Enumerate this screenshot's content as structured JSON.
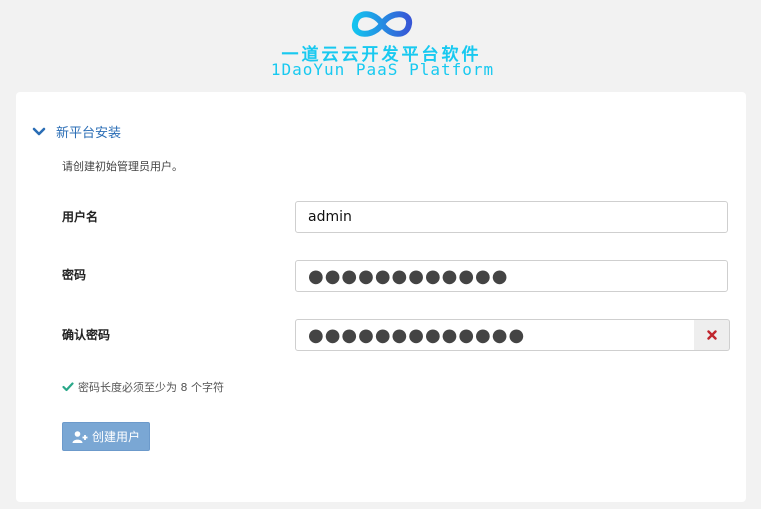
{
  "brand": {
    "name_cn": "一道云云开发平台软件",
    "name_en": "1DaoYun PaaS Platform",
    "accent_color": "#18c9f0",
    "logo_icon": "infinity-logo-icon"
  },
  "section": {
    "title": "新平台安装",
    "description": "请创建初始管理员用户。"
  },
  "form": {
    "username_label": "用户名",
    "username_value": "admin",
    "password_label": "密码",
    "password_value": "●●●●●●●●●●●●",
    "confirm_label": "确认密码",
    "confirm_value": "●●●●●●●●●●●●●",
    "clear_icon": "close-icon",
    "hint_icon": "check-icon",
    "hint_text": "密码长度必须至少为 8 个字符",
    "hint_color": "#2aa889"
  },
  "actions": {
    "create_label": "创建用户",
    "create_icon": "add-user-icon",
    "button_color": "#7aa7d4"
  }
}
